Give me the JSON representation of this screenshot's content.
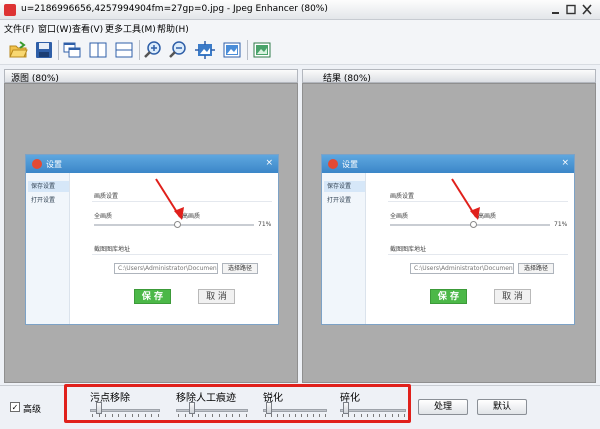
{
  "window": {
    "title": "u=2186996656,4257994904fm=27gp=0.jpg - Jpeg Enhancer (80%)",
    "controls": [
      "0",
      "1",
      "r"
    ]
  },
  "menu": [
    "文件(F)",
    "窗口(W)",
    "查看(V)",
    "更多工具(M)",
    "帮助(H)"
  ],
  "toolbar": {
    "icons": [
      "open-folder-icon",
      "save-disk-icon",
      "window-cascade-icon",
      "split-vertical-icon",
      "split-horizontal-icon",
      "zoom-in-icon",
      "zoom-out-icon",
      "fit-window-icon",
      "actual-size-icon",
      "image-view-icon"
    ]
  },
  "panes": {
    "source_title": "源图 (80%)",
    "result_title": "结果 (80%)"
  },
  "dialog": {
    "title": "设置",
    "close": "×",
    "side_items": [
      "保存设置",
      "打开设置"
    ],
    "quality_label": "画质设置",
    "left_label": "全画质",
    "right_label": "高画质",
    "value_label": "71%",
    "path_label": "截图图库地址",
    "path_value": "C:\\Users\\Administrator\\Documents",
    "pick_label": "选择路径",
    "save_label": "保 存",
    "cancel_label": "取 消"
  },
  "bottom": {
    "advanced_label": "高级",
    "advanced_checked": true,
    "check_mark": "✓",
    "sliders": [
      {
        "label": "污点移除",
        "value": 0.1
      },
      {
        "label": "移除人工痕迹",
        "value": 0.2
      },
      {
        "label": "锐化",
        "value": 0.05
      },
      {
        "label": "碎化",
        "value": 0.05
      }
    ],
    "process_label": "处理",
    "default_label": "默认"
  },
  "colors": {
    "highlight": "#e0201b",
    "save_green": "#4cb848",
    "dialog_blue": "#3b86c8"
  }
}
